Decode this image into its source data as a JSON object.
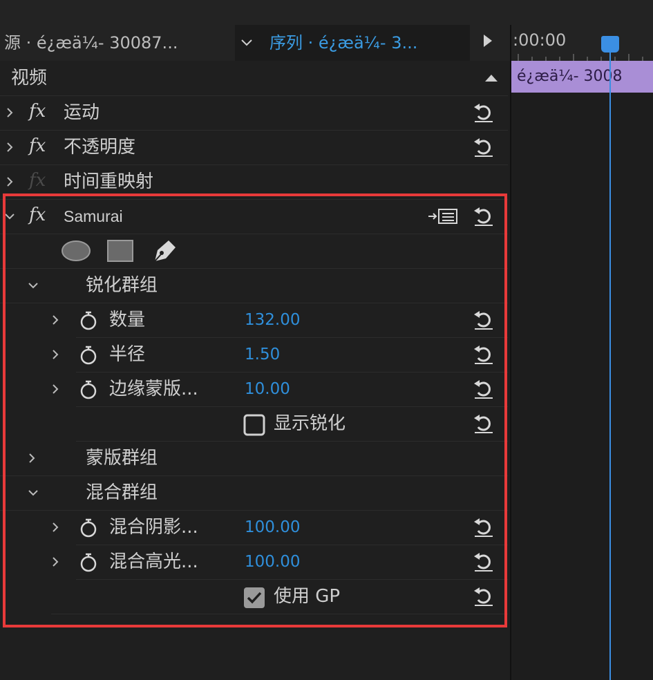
{
  "tabs": {
    "source_label": "源 · é¿æä¼- 30087...",
    "sequence_label": "序列 · é¿æä¼- 3..."
  },
  "timeline": {
    "timecode": ":00:00",
    "clip_label": "é¿æä¼- 3008"
  },
  "section": {
    "title": "视频"
  },
  "effects": {
    "motion": "运动",
    "opacity": "不透明度",
    "time_remap": "时间重映射",
    "samurai": "Samurai"
  },
  "samurai": {
    "sharpen_group": "锐化群组",
    "params": [
      {
        "label": "数量",
        "value": "132.00"
      },
      {
        "label": "半径",
        "value": "1.50"
      },
      {
        "label": "边缘蒙版...",
        "value": "10.00"
      }
    ],
    "show_sharpen": {
      "label": "显示锐化",
      "checked": false
    },
    "mask_group": "蒙版群组",
    "blend_group": "混合群组",
    "blend_params": [
      {
        "label": "混合阴影...",
        "value": "100.00"
      },
      {
        "label": "混合高光...",
        "value": "100.00"
      }
    ],
    "use_gpu": {
      "label": "使用 GP",
      "checked": true
    }
  },
  "colors": {
    "accent": "#2f8fdb",
    "highlight": "#e83a3a",
    "clip": "#a98ed6"
  }
}
